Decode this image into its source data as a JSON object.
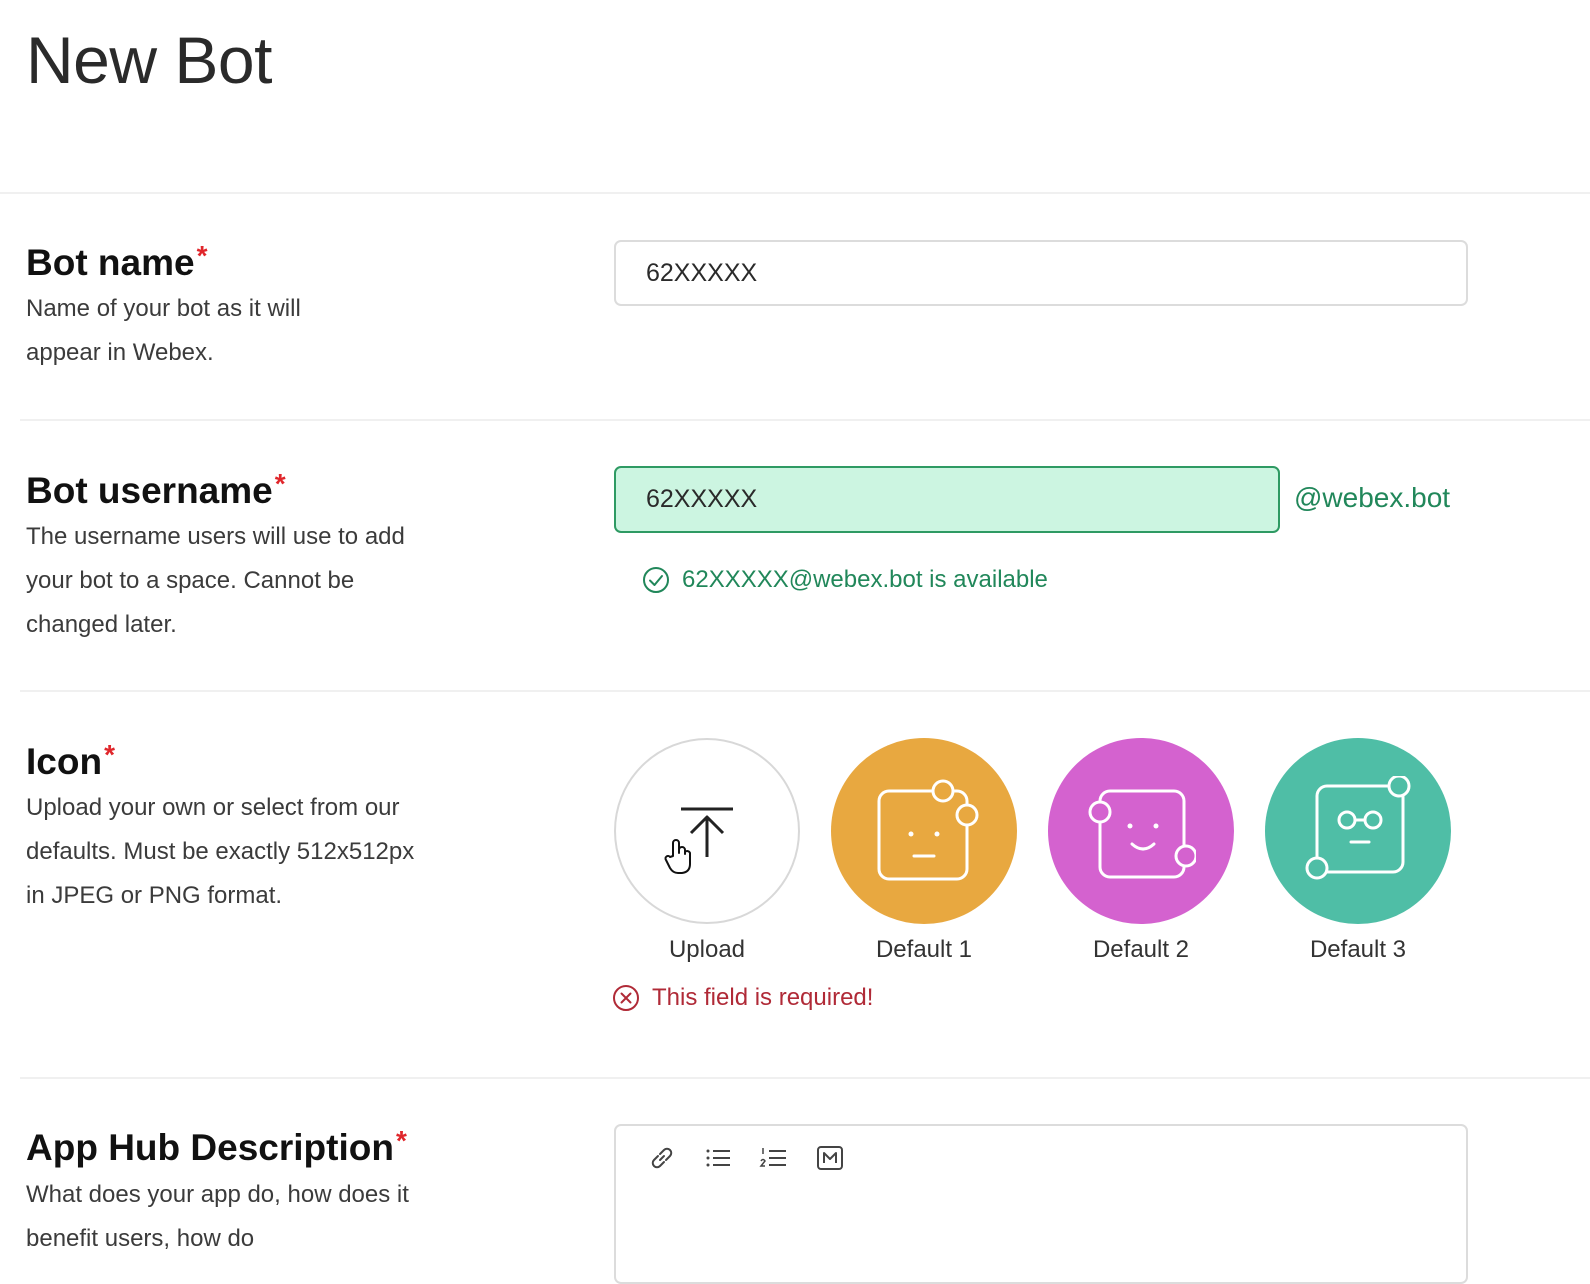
{
  "page": {
    "title": "New Bot"
  },
  "sections": {
    "bot_name": {
      "title": "Bot name",
      "required_mark": "*",
      "description": "Name of your bot as it will appear in Webex.",
      "value": "62XXXXX"
    },
    "bot_username": {
      "title": "Bot username",
      "required_mark": "*",
      "description": "The username users will use to add your bot to a space. Cannot be changed later.",
      "value": "62XXXXX",
      "suffix": "@webex.bot",
      "availability_message": "62XXXXX@webex.bot is available"
    },
    "icon": {
      "title": "Icon",
      "required_mark": "*",
      "description": "Upload your own or select from our defaults. Must be exactly 512x512px in JPEG or PNG format.",
      "options": [
        {
          "label": "Upload",
          "icon": "upload-icon"
        },
        {
          "label": "Default 1",
          "color": "#e8a840",
          "icon": "robot-face-icon"
        },
        {
          "label": "Default 2",
          "color": "#d462cf",
          "icon": "robot-face-icon"
        },
        {
          "label": "Default 3",
          "color": "#4fbea6",
          "icon": "robot-face-icon"
        }
      ],
      "error_message": "This field is required!"
    },
    "app_hub_description": {
      "title": "App Hub Description",
      "required_mark": "*",
      "description": "What does your app do, how does it benefit users, how do",
      "toolbar": [
        "link-icon",
        "bulleted-list-icon",
        "numbered-list-icon",
        "markdown-icon"
      ]
    }
  },
  "colors": {
    "success": "#21875a",
    "error": "#b02a37",
    "required": "#e0262b"
  }
}
